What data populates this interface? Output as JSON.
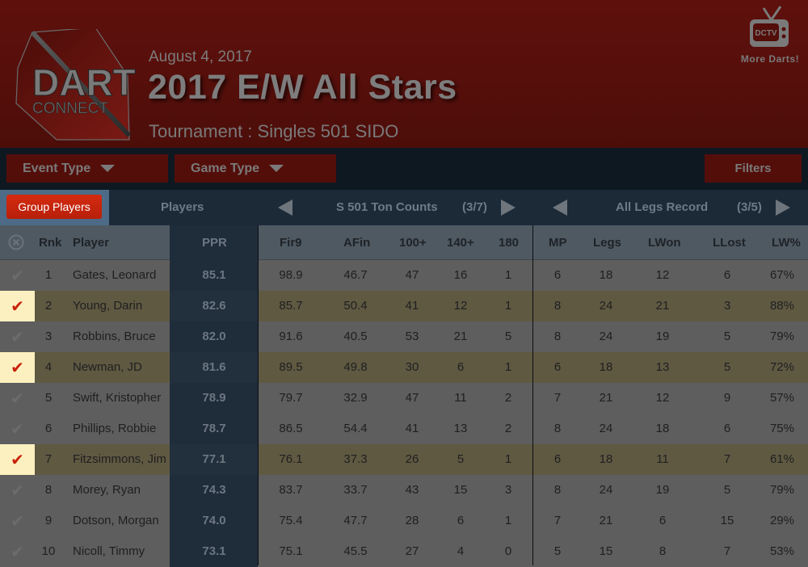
{
  "header": {
    "logo_text_top": "DART",
    "logo_text_bottom": "CONNECT",
    "date": "August 4, 2017",
    "title": "2017 E/W All Stars",
    "subtitle": "Tournament : Singles 501 SIDO",
    "dctv": {
      "icon": "tv-icon",
      "screen_text": "DCTV",
      "label": "More Darts!"
    }
  },
  "toolbar": {
    "event_type": "Event Type",
    "game_type": "Game Type",
    "filters": "Filters"
  },
  "navbar": {
    "group_players": "Group Players",
    "players_label": "Players",
    "section1": {
      "title": "S 501 Ton Counts",
      "page": "(3/7)"
    },
    "section2": {
      "title": "All Legs Record",
      "page": "(3/5)"
    }
  },
  "columns": [
    "Rnk",
    "Player",
    "PPR",
    "Fir9",
    "AFin",
    "100+",
    "140+",
    "180",
    "MP",
    "Legs",
    "LWon",
    "LLost",
    "LW%"
  ],
  "colors": {
    "selected_check": "#c8210a",
    "group_button": "#d42b10",
    "header_bg": "#5e100c"
  },
  "rows": [
    {
      "selected": false,
      "rnk": "1",
      "player": "Gates, Leonard",
      "ppr": "85.1",
      "fir9": "98.9",
      "afin": "46.7",
      "t100": "47",
      "t140": "16",
      "t180": "1",
      "mp": "6",
      "legs": "18",
      "lwon": "12",
      "llost": "6",
      "lwp": "67%"
    },
    {
      "selected": true,
      "rnk": "2",
      "player": "Young, Darin",
      "ppr": "82.6",
      "fir9": "85.7",
      "afin": "50.4",
      "t100": "41",
      "t140": "12",
      "t180": "1",
      "mp": "8",
      "legs": "24",
      "lwon": "21",
      "llost": "3",
      "lwp": "88%"
    },
    {
      "selected": false,
      "rnk": "3",
      "player": "Robbins, Bruce",
      "ppr": "82.0",
      "fir9": "91.6",
      "afin": "40.5",
      "t100": "53",
      "t140": "21",
      "t180": "5",
      "mp": "8",
      "legs": "24",
      "lwon": "19",
      "llost": "5",
      "lwp": "79%"
    },
    {
      "selected": true,
      "rnk": "4",
      "player": "Newman, JD",
      "ppr": "81.6",
      "fir9": "89.5",
      "afin": "49.8",
      "t100": "30",
      "t140": "6",
      "t180": "1",
      "mp": "6",
      "legs": "18",
      "lwon": "13",
      "llost": "5",
      "lwp": "72%"
    },
    {
      "selected": false,
      "rnk": "5",
      "player": "Swift, Kristopher",
      "ppr": "78.9",
      "fir9": "79.7",
      "afin": "32.9",
      "t100": "47",
      "t140": "11",
      "t180": "2",
      "mp": "7",
      "legs": "21",
      "lwon": "12",
      "llost": "9",
      "lwp": "57%"
    },
    {
      "selected": false,
      "rnk": "6",
      "player": "Phillips, Robbie",
      "ppr": "78.7",
      "fir9": "86.5",
      "afin": "54.4",
      "t100": "41",
      "t140": "13",
      "t180": "2",
      "mp": "8",
      "legs": "24",
      "lwon": "18",
      "llost": "6",
      "lwp": "75%"
    },
    {
      "selected": true,
      "rnk": "7",
      "player": "Fitzsimmons, Jim",
      "ppr": "77.1",
      "fir9": "76.1",
      "afin": "37.3",
      "t100": "26",
      "t140": "5",
      "t180": "1",
      "mp": "6",
      "legs": "18",
      "lwon": "11",
      "llost": "7",
      "lwp": "61%"
    },
    {
      "selected": false,
      "rnk": "8",
      "player": "Morey, Ryan",
      "ppr": "74.3",
      "fir9": "83.7",
      "afin": "33.7",
      "t100": "43",
      "t140": "15",
      "t180": "3",
      "mp": "8",
      "legs": "24",
      "lwon": "19",
      "llost": "5",
      "lwp": "79%"
    },
    {
      "selected": false,
      "rnk": "9",
      "player": "Dotson, Morgan",
      "ppr": "74.0",
      "fir9": "75.4",
      "afin": "47.7",
      "t100": "28",
      "t140": "6",
      "t180": "1",
      "mp": "7",
      "legs": "21",
      "lwon": "6",
      "llost": "15",
      "lwp": "29%"
    },
    {
      "selected": false,
      "rnk": "10",
      "player": "Nicoll, Timmy",
      "ppr": "73.1",
      "fir9": "75.1",
      "afin": "45.5",
      "t100": "27",
      "t140": "4",
      "t180": "0",
      "mp": "5",
      "legs": "15",
      "lwon": "8",
      "llost": "7",
      "lwp": "53%"
    }
  ]
}
